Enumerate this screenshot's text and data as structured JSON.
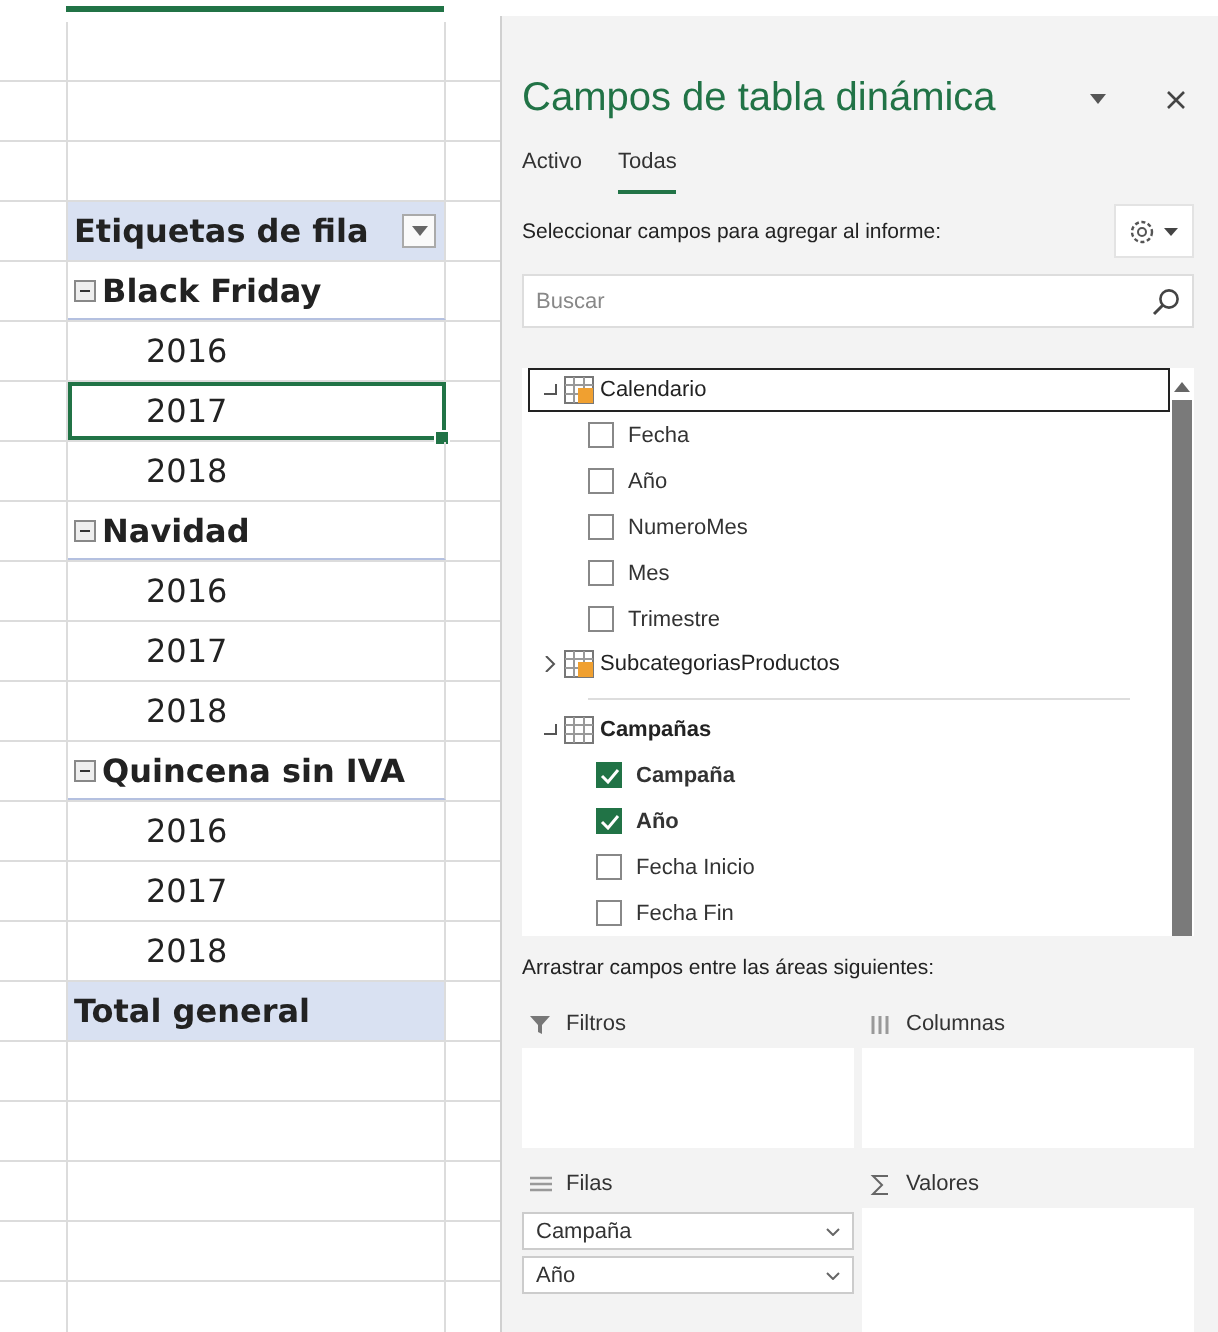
{
  "pivot": {
    "header": "Etiquetas de fila",
    "groups": [
      {
        "label": "Black Friday",
        "expanded": true,
        "children": [
          {
            "label": "2016",
            "selected": false
          },
          {
            "label": "2017",
            "selected": true
          },
          {
            "label": "2018",
            "selected": false
          }
        ]
      },
      {
        "label": "Navidad",
        "expanded": true,
        "children": [
          {
            "label": "2016",
            "selected": false
          },
          {
            "label": "2017",
            "selected": false
          },
          {
            "label": "2018",
            "selected": false
          }
        ]
      },
      {
        "label": "Quincena sin IVA",
        "expanded": true,
        "children": [
          {
            "label": "2016",
            "selected": false
          },
          {
            "label": "2017",
            "selected": false
          },
          {
            "label": "2018",
            "selected": false
          }
        ]
      }
    ],
    "total": "Total general"
  },
  "panel": {
    "title": "Campos de tabla dinámica",
    "tabs": [
      {
        "label": "Activo",
        "selected": false
      },
      {
        "label": "Todas",
        "selected": true
      }
    ],
    "instruction": "Seleccionar campos para agregar al informe:",
    "search": {
      "placeholder": "Buscar"
    },
    "tables": [
      {
        "name": "Calendario",
        "kind": "marked",
        "expanded": true,
        "selected": true,
        "fields": [
          {
            "name": "Fecha",
            "checked": false
          },
          {
            "name": "Año",
            "checked": false
          },
          {
            "name": "NumeroMes",
            "checked": false
          },
          {
            "name": "Mes",
            "checked": false
          },
          {
            "name": "Trimestre",
            "checked": false
          }
        ]
      },
      {
        "name": "SubcategoriasProductos",
        "kind": "marked",
        "expanded": false,
        "selected": false
      },
      {
        "name": "Campañas",
        "kind": "plain",
        "expanded": true,
        "selected": false,
        "fields": [
          {
            "name": "Campaña",
            "checked": true
          },
          {
            "name": "Año",
            "checked": true
          },
          {
            "name": "Fecha Inicio",
            "checked": false
          },
          {
            "name": "Fecha Fin",
            "checked": false
          }
        ]
      }
    ],
    "drag_hint": "Arrastrar campos entre las áreas siguientes:",
    "areas": [
      {
        "kind": "filters",
        "title": "Filtros"
      },
      {
        "kind": "columns",
        "title": "Columnas"
      },
      {
        "kind": "rows",
        "title": "Filas",
        "items": [
          "Campaña",
          "Año"
        ]
      },
      {
        "kind": "values",
        "title": "Valores"
      }
    ]
  }
}
